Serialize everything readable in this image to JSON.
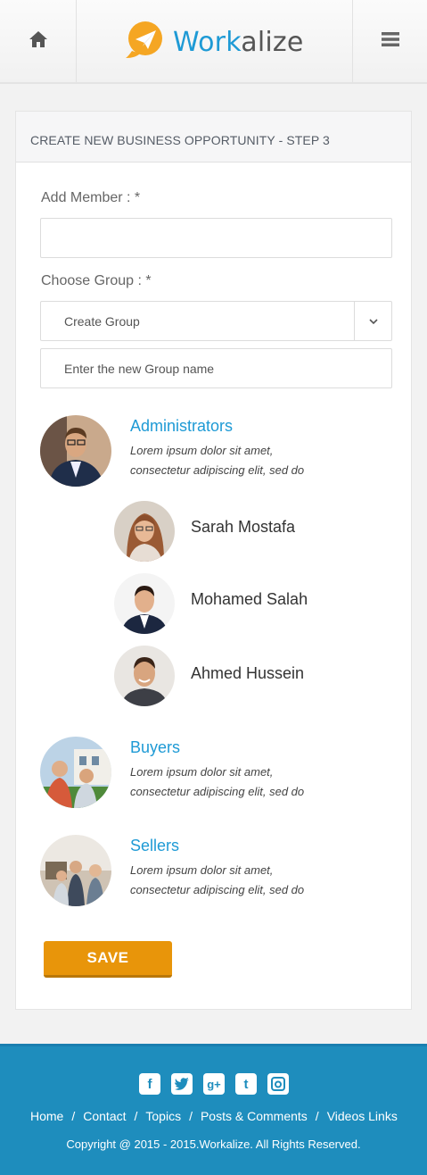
{
  "header": {
    "logo_part1": "Work",
    "logo_part2": "alize",
    "home_icon": "home-icon",
    "menu_icon": "hamburger-menu-icon",
    "brand_color": "#1e9ad5",
    "accent_color": "#f5a623"
  },
  "form": {
    "title": "CREATE NEW BUSINESS OPPORTUNITY - STEP 3",
    "add_member_label": "Add Member : *",
    "add_member_value": "",
    "choose_group_label": "Choose Group : *",
    "choose_group_selected": "Create Group",
    "new_group_placeholder": "Enter the new Group name",
    "save_label": "SAVE",
    "save_color": "#e8950a"
  },
  "groups": [
    {
      "title": "Administrators",
      "desc_line1": "Lorem ipsum dolor sit amet,",
      "desc_line2": "consectetur adipiscing elit, sed do",
      "members": [
        "Sarah Mostafa",
        "Mohamed Salah",
        "Ahmed Hussein"
      ]
    },
    {
      "title": "Buyers",
      "desc_line1": "Lorem ipsum dolor sit amet,",
      "desc_line2": "consectetur adipiscing elit, sed do"
    },
    {
      "title": "Sellers",
      "desc_line1": "Lorem ipsum dolor sit amet,",
      "desc_line2": "consectetur adipiscing elit, sed do"
    }
  ],
  "footer": {
    "social_icons": [
      "facebook-icon",
      "twitter-icon",
      "google-plus-icon",
      "tumblr-icon",
      "instagram-icon"
    ],
    "links": [
      "Home",
      "Contact",
      "Topics",
      "Posts & Comments",
      "Videos Links"
    ],
    "separator": "/",
    "copyright": "Copyright @ 2015 - 2015.Workalize. All Rights Reserved.",
    "bg_color": "#1e8dbd"
  }
}
